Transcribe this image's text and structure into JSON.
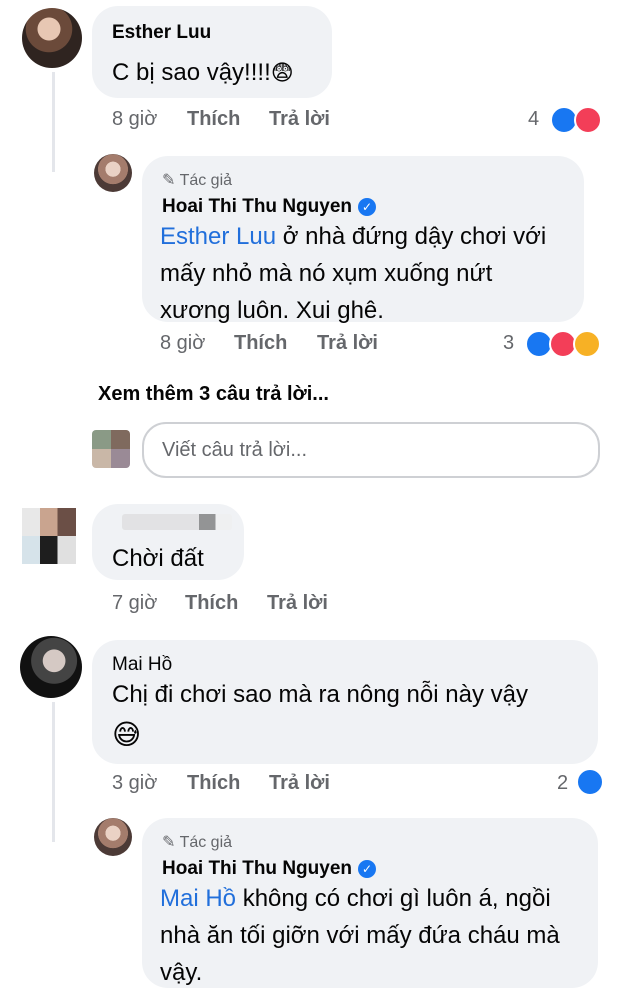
{
  "comments": [
    {
      "name": "Esther Luu",
      "text": "C bị sao vậy!!!!",
      "emoji": "😨",
      "time": "8 giờ",
      "like_label": "Thích",
      "reply_label": "Trả lời",
      "reaction_count": "4",
      "reactions": [
        "like-icon",
        "love-icon"
      ]
    },
    {
      "author_tag": "Tác giả",
      "name": "Hoai Thi Thu Nguyen",
      "mention": "Esther Luu",
      "text_line1": " ở nhà đứng dậy chơi với",
      "text_line2": "mấy nhỏ mà nó xụm xuống nứt",
      "text_line3": "xương luôn. Xui ghê.",
      "time": "8 giờ",
      "like_label": "Thích",
      "reply_label": "Trả lời",
      "reaction_count": "3",
      "reactions": [
        "like-icon",
        "love-icon",
        "wow-icon"
      ]
    },
    {
      "text": "Chời đất",
      "time": "7 giờ",
      "like_label": "Thích",
      "reply_label": "Trả lời"
    },
    {
      "name": "Mai Hồ",
      "text": "Chị đi chơi sao mà ra nông nỗi này vậy",
      "emoji": "😅",
      "time": "3 giờ",
      "like_label": "Thích",
      "reply_label": "Trả lời",
      "reaction_count": "2",
      "reactions": [
        "like-icon"
      ]
    },
    {
      "author_tag": "Tác giả",
      "name": "Hoai Thi Thu Nguyen",
      "mention": "Mai Hồ",
      "text_line1": " không có chơi gì luôn á, ngồi",
      "text_line2": "nhà ăn tối giỡn với mấy đứa cháu mà",
      "text_line3": "vậy."
    }
  ],
  "view_more": "Xem thêm 3 câu trả lời...",
  "reply_placeholder": "Viết câu trả lời...",
  "colors": {
    "bubble": "#f0f2f5",
    "mention": "#216fdb",
    "like": "#1877f2",
    "love": "#f33e58",
    "muted": "#65676b"
  }
}
